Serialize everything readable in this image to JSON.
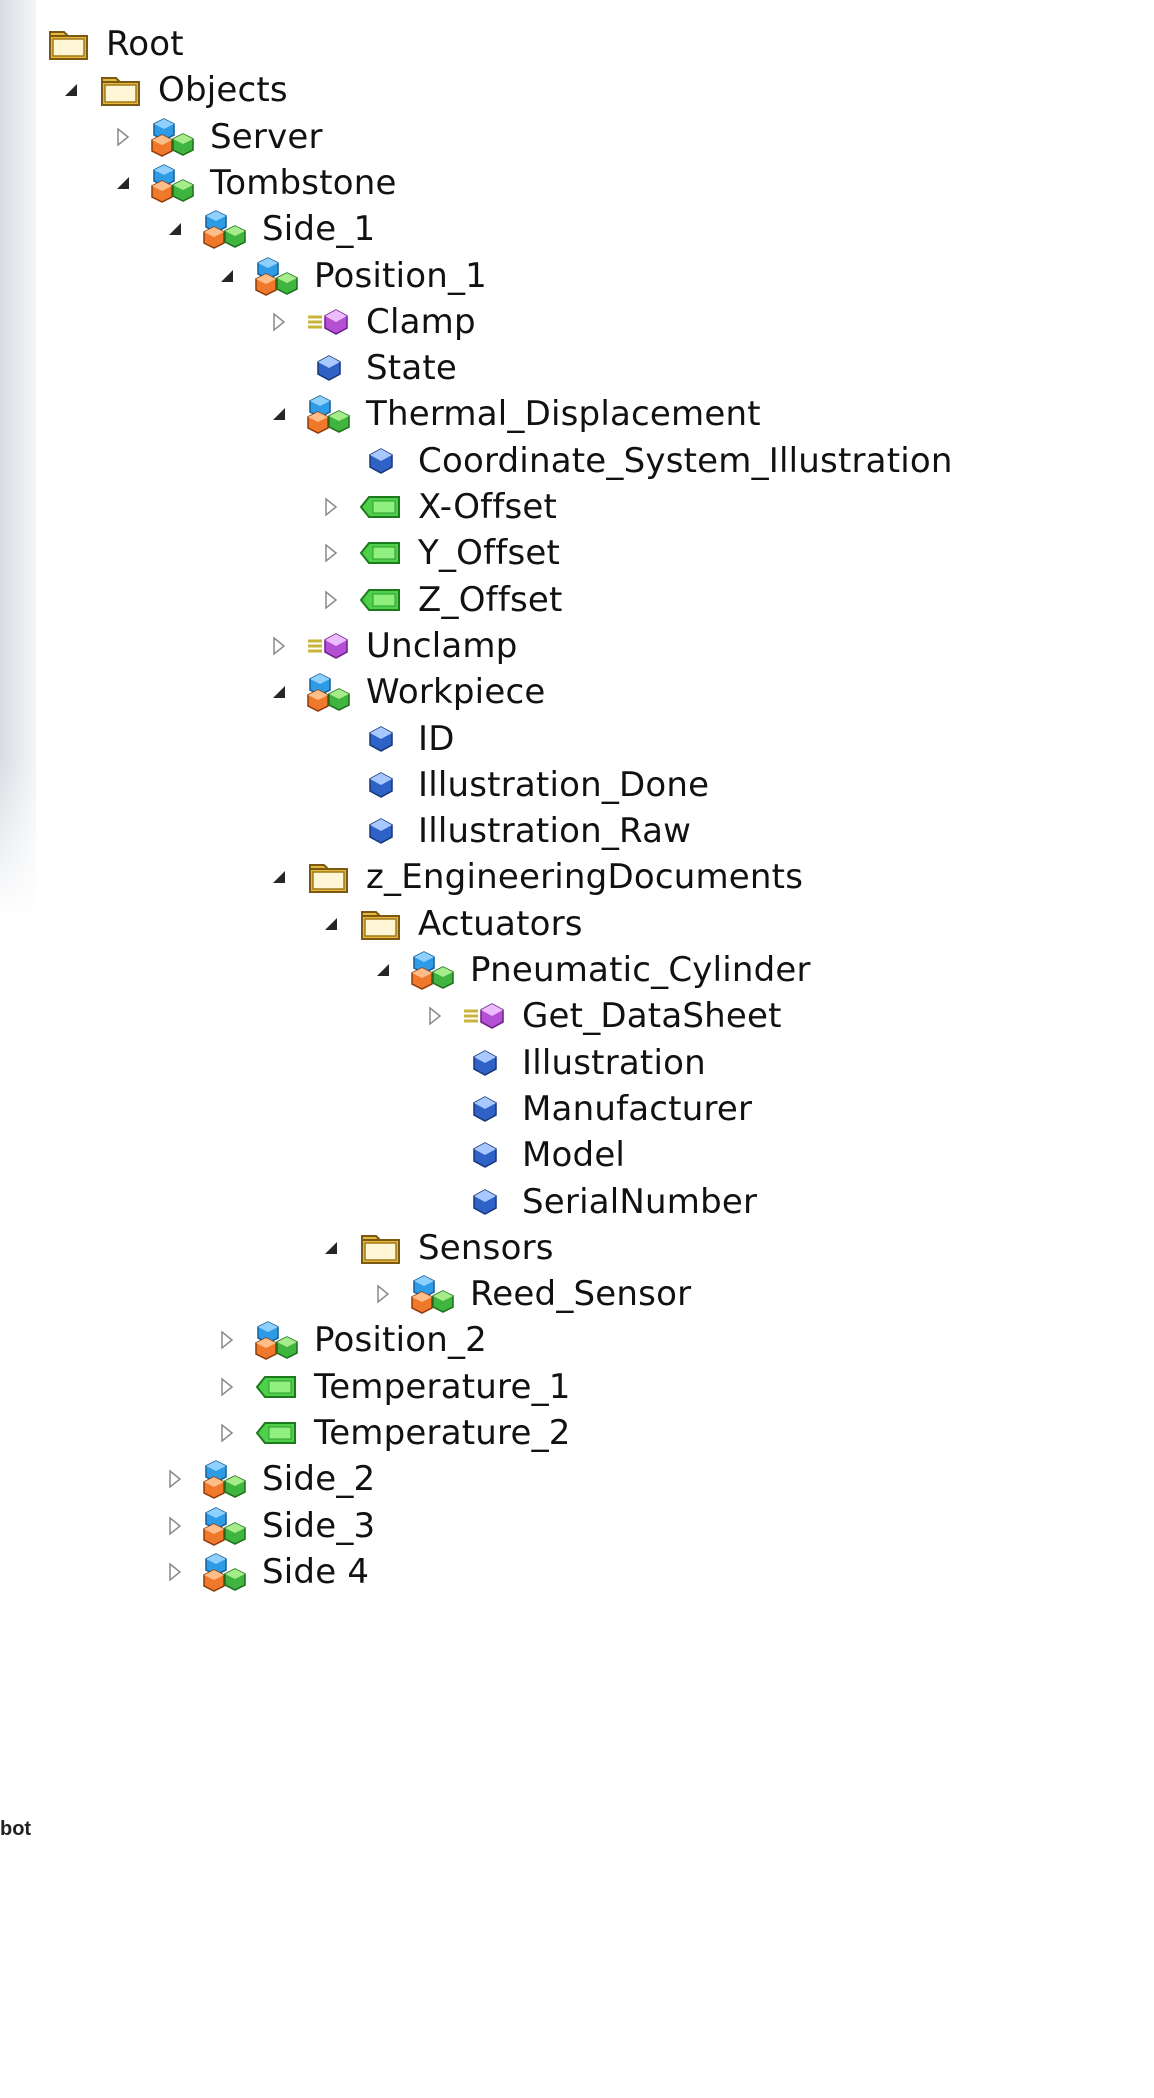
{
  "side_text": "bot",
  "tree": [
    {
      "label": "Root",
      "level": 0,
      "icon": "folder-icon",
      "expander": "none"
    },
    {
      "label": "Objects",
      "level": 1,
      "icon": "folder-icon",
      "expander": "expanded"
    },
    {
      "label": "Server",
      "level": 2,
      "icon": "object-icon",
      "expander": "collapsed"
    },
    {
      "label": "Tombstone",
      "level": 2,
      "icon": "object-icon",
      "expander": "expanded"
    },
    {
      "label": "Side_1",
      "level": 3,
      "icon": "object-icon",
      "expander": "expanded"
    },
    {
      "label": "Position_1",
      "level": 4,
      "icon": "object-icon",
      "expander": "expanded"
    },
    {
      "label": "Clamp",
      "level": 5,
      "icon": "method-icon",
      "expander": "collapsed"
    },
    {
      "label": "State",
      "level": 5,
      "icon": "property-icon",
      "expander": "none"
    },
    {
      "label": "Thermal_Displacement",
      "level": 5,
      "icon": "object-icon",
      "expander": "expanded"
    },
    {
      "label": "Coordinate_System_Illustration",
      "level": 6,
      "icon": "property-icon",
      "expander": "none"
    },
    {
      "label": "X-Offset",
      "level": 6,
      "icon": "variable-icon",
      "expander": "collapsed"
    },
    {
      "label": "Y_Offset",
      "level": 6,
      "icon": "variable-icon",
      "expander": "collapsed"
    },
    {
      "label": "Z_Offset",
      "level": 6,
      "icon": "variable-icon",
      "expander": "collapsed"
    },
    {
      "label": "Unclamp",
      "level": 5,
      "icon": "method-icon",
      "expander": "collapsed"
    },
    {
      "label": "Workpiece",
      "level": 5,
      "icon": "object-icon",
      "expander": "expanded"
    },
    {
      "label": "ID",
      "level": 6,
      "icon": "property-icon",
      "expander": "none"
    },
    {
      "label": "Illustration_Done",
      "level": 6,
      "icon": "property-icon",
      "expander": "none"
    },
    {
      "label": "Illustration_Raw",
      "level": 6,
      "icon": "property-icon",
      "expander": "none"
    },
    {
      "label": "z_EngineeringDocuments",
      "level": 5,
      "icon": "folder-icon",
      "expander": "expanded"
    },
    {
      "label": "Actuators",
      "level": 6,
      "icon": "folder-icon",
      "expander": "expanded"
    },
    {
      "label": "Pneumatic_Cylinder",
      "level": 7,
      "icon": "object-icon",
      "expander": "expanded"
    },
    {
      "label": "Get_DataSheet",
      "level": 8,
      "icon": "method-icon",
      "expander": "collapsed"
    },
    {
      "label": "Illustration",
      "level": 8,
      "icon": "property-icon",
      "expander": "none"
    },
    {
      "label": "Manufacturer",
      "level": 8,
      "icon": "property-icon",
      "expander": "none"
    },
    {
      "label": "Model",
      "level": 8,
      "icon": "property-icon",
      "expander": "none"
    },
    {
      "label": "SerialNumber",
      "level": 8,
      "icon": "property-icon",
      "expander": "none"
    },
    {
      "label": "Sensors",
      "level": 6,
      "icon": "folder-icon",
      "expander": "expanded"
    },
    {
      "label": "Reed_Sensor",
      "level": 7,
      "icon": "object-icon",
      "expander": "collapsed"
    },
    {
      "label": "Position_2",
      "level": 4,
      "icon": "object-icon",
      "expander": "collapsed"
    },
    {
      "label": "Temperature_1",
      "level": 4,
      "icon": "variable-icon",
      "expander": "collapsed"
    },
    {
      "label": "Temperature_2",
      "level": 4,
      "icon": "variable-icon",
      "expander": "collapsed"
    },
    {
      "label": "Side_2",
      "level": 3,
      "icon": "object-icon",
      "expander": "collapsed"
    },
    {
      "label": "Side_3",
      "level": 3,
      "icon": "object-icon",
      "expander": "collapsed"
    },
    {
      "label": "Side 4",
      "level": 3,
      "icon": "object-icon",
      "expander": "collapsed"
    }
  ]
}
